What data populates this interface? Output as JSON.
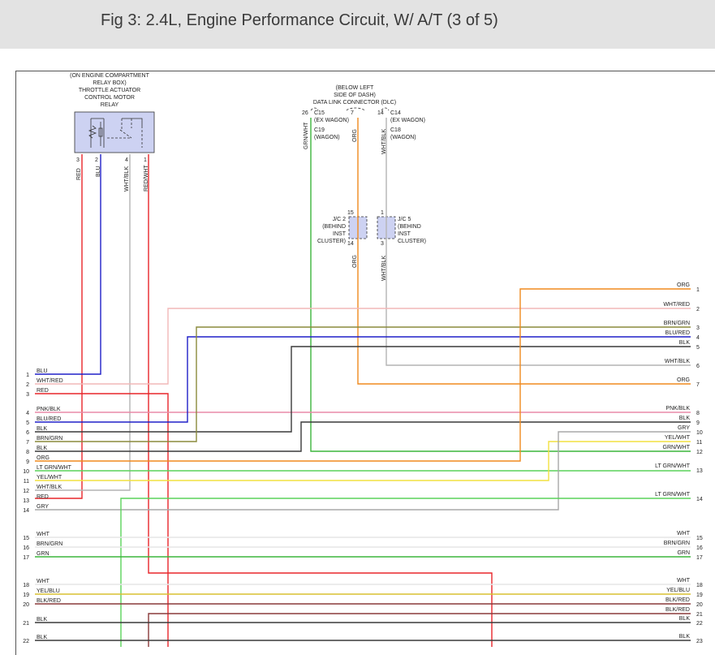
{
  "title": "Fig 3: 2.4L, Engine Performance Circuit, W/ A/T (3 of 5)",
  "relay": {
    "lines": [
      "(ON ENGINE COMPARTMENT",
      "RELAY BOX)",
      "THROTTLE ACTUATOR",
      "CONTROL MOTOR",
      "RELAY"
    ],
    "pins": [
      "3",
      "2",
      "4",
      "1"
    ],
    "wire_labels": [
      "RED",
      "BLU",
      "WHT/BLK",
      "RED/WHT"
    ],
    "wire_colors": [
      "#e8262a",
      "#2020c8",
      "#b4b4b4",
      "#e8262a"
    ]
  },
  "dlc": {
    "lines": [
      "(BELOW LEFT",
      "SIDE OF DASH)",
      "DATA LINK CONNECTOR (DLC)"
    ],
    "pins": [
      "26",
      "7",
      "14"
    ],
    "labels_left": [
      "C15",
      "(EX WAGON)",
      "C19",
      "(WAGON)"
    ],
    "labels_right": [
      "C14",
      "(EX WAGON)",
      "C18",
      "(WAGON)"
    ],
    "wire_labels": [
      "GRN/WHT",
      "ORG",
      "WHT/BLK"
    ],
    "wire_colors": [
      "#3cb53c",
      "#f08a1e",
      "#b4b4b4"
    ]
  },
  "jc2": {
    "top_pin": "15",
    "bottom_pin": "14",
    "lines": [
      "J/C 2",
      "(BEHIND",
      "INST",
      "CLUSTER)"
    ],
    "wire_label": "ORG"
  },
  "jc5": {
    "top_pin": "1",
    "bottom_pin": "3",
    "lines": [
      "J/C 5",
      "(BEHIND",
      "INST",
      "CLUSTER)"
    ],
    "wire_label": "WHT/BLK"
  },
  "left_rows": [
    {
      "num": "1",
      "label": "BLU"
    },
    {
      "num": "2",
      "label": "WHT/RED"
    },
    {
      "num": "3",
      "label": "RED"
    },
    {
      "num": "4",
      "label": "PNK/BLK"
    },
    {
      "num": "5",
      "label": "BLU/RED"
    },
    {
      "num": "6",
      "label": "BLK"
    },
    {
      "num": "7",
      "label": "BRN/GRN"
    },
    {
      "num": "8",
      "label": "BLK"
    },
    {
      "num": "9",
      "label": "ORG"
    },
    {
      "num": "10",
      "label": "LT GRN/WHT"
    },
    {
      "num": "11",
      "label": "YEL/WHT"
    },
    {
      "num": "12",
      "label": "WHT/BLK"
    },
    {
      "num": "13",
      "label": "RED"
    },
    {
      "num": "14",
      "label": "GRY"
    },
    {
      "num": "15",
      "label": "WHT"
    },
    {
      "num": "16",
      "label": "BRN/GRN"
    },
    {
      "num": "17",
      "label": "GRN"
    },
    {
      "num": "18",
      "label": "WHT"
    },
    {
      "num": "19",
      "label": "YEL/BLU"
    },
    {
      "num": "20",
      "label": "BLK/RED"
    },
    {
      "num": "21",
      "label": "BLK"
    },
    {
      "num": "22",
      "label": "BLK"
    }
  ],
  "right_rows": [
    {
      "num": "1",
      "label": "ORG"
    },
    {
      "num": "2",
      "label": "WHT/RED"
    },
    {
      "num": "3",
      "label": "BRN/GRN"
    },
    {
      "num": "4",
      "label": "BLU/RED"
    },
    {
      "num": "5",
      "label": "BLK"
    },
    {
      "num": "6",
      "label": "WHT/BLK"
    },
    {
      "num": "7",
      "label": "ORG"
    },
    {
      "num": "8",
      "label": "PNK/BLK"
    },
    {
      "num": "9",
      "label": "BLK"
    },
    {
      "num": "10",
      "label": "GRY"
    },
    {
      "num": "11",
      "label": "YEL/WHT"
    },
    {
      "num": "12",
      "label": "GRN/WHT"
    },
    {
      "num": "13",
      "label": "LT GRN/WHT"
    },
    {
      "num": "14",
      "label": "LT GRN/WHT"
    },
    {
      "num": "15",
      "label": "WHT"
    },
    {
      "num": "16",
      "label": "BRN/GRN"
    },
    {
      "num": "17",
      "label": "GRN"
    },
    {
      "num": "18",
      "label": "WHT"
    },
    {
      "num": "19",
      "label": "YEL/BLU"
    },
    {
      "num": "20",
      "label": "BLK/RED"
    },
    {
      "num": "21",
      "label": "BLK/RED"
    },
    {
      "num": "22",
      "label": "BLK"
    },
    {
      "num": "23",
      "label": "BLK"
    }
  ],
  "colors": {
    "red": "#e8262a",
    "blue": "#2020c8",
    "white_red": "#f2b8b8",
    "pink_black": "#e88aa8",
    "black": "#3a3a3a",
    "brown_green": "#8a8a3c",
    "orange": "#f08a1e",
    "lt_green": "#5ad25a",
    "yellow": "#f2e040",
    "white_black": "#b4b4b4",
    "gray": "#a8a8a8",
    "white": "#e6e6e6",
    "green": "#3cb53c",
    "yel_blu": "#d8c030",
    "blk_red": "#8a3a3a",
    "box_fill": "#cdd2f2"
  }
}
